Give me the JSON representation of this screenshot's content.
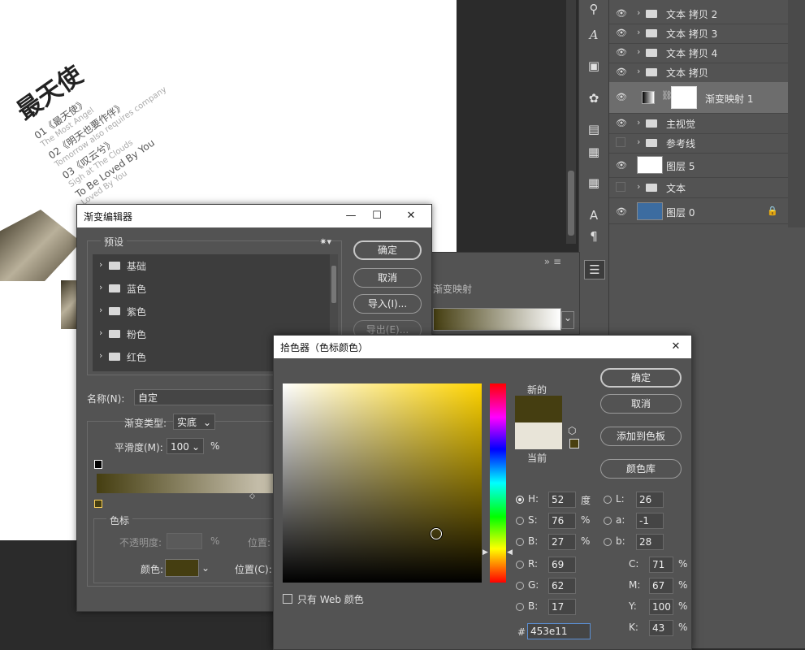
{
  "poster": {
    "title": "最天使",
    "items": [
      {
        "t": "01《最天使》",
        "s": "The Most Angel"
      },
      {
        "t": "02《明天也要作伴》",
        "s": "Tomorrow also requires company"
      },
      {
        "t": "03《叹云兮》",
        "s": "Sigh at The Clouds"
      },
      {
        "t": "To Be Loved By You",
        "s": "Loved By You"
      }
    ]
  },
  "layers": [
    {
      "name": "文本 拷贝 2",
      "type": "folder",
      "visible": true
    },
    {
      "name": "文本 拷贝 3",
      "type": "folder",
      "visible": true
    },
    {
      "name": "文本 拷贝 4",
      "type": "folder",
      "visible": true
    },
    {
      "name": "文本 拷贝",
      "type": "folder",
      "visible": true
    },
    {
      "name": "渐变映射 1",
      "type": "adjustment",
      "visible": true,
      "selected": true
    },
    {
      "name": "主视觉",
      "type": "folder",
      "visible": true
    },
    {
      "name": "参考线",
      "type": "folder",
      "visible": false
    },
    {
      "name": "图层 5",
      "type": "white",
      "visible": true
    },
    {
      "name": "文本",
      "type": "folder",
      "visible": false
    },
    {
      "name": "图层 0",
      "type": "blue",
      "visible": true,
      "locked": true
    }
  ],
  "adjpanel": {
    "title": "渐变映射"
  },
  "gradient_editor": {
    "title": "渐变编辑器",
    "presets_label": "预设",
    "presets": [
      "基础",
      "蓝色",
      "紫色",
      "粉色",
      "红色"
    ],
    "ok": "确定",
    "cancel": "取消",
    "import": "导入(I)...",
    "export": "导出(E)...",
    "name_label": "名称(N):",
    "name_value": "自定",
    "type_label": "渐变类型:",
    "type_value": "实底",
    "smooth_label": "平滑度(M):",
    "smooth_value": "100",
    "smooth_unit": "%",
    "stops_label": "色标",
    "opacity_label": "不透明度:",
    "opacity_unit": "%",
    "location_label": "位置:",
    "color_label": "颜色:",
    "location_c_label": "位置(C):",
    "stop_color": "#453e11"
  },
  "color_picker": {
    "title": "拾色器（色标颜色）",
    "ok": "确定",
    "cancel": "取消",
    "add_swatch": "添加到色板",
    "libraries": "颜色库",
    "new_label": "新的",
    "current_label": "当前",
    "new_color": "#453e11",
    "current_color": "#e8e4d8",
    "web_only": "只有 Web 颜色",
    "hsb": [
      {
        "k": "H:",
        "v": "52",
        "u": "度",
        "on": true
      },
      {
        "k": "S:",
        "v": "76",
        "u": "%"
      },
      {
        "k": "B:",
        "v": "27",
        "u": "%"
      }
    ],
    "rgb": [
      {
        "k": "R:",
        "v": "69"
      },
      {
        "k": "G:",
        "v": "62"
      },
      {
        "k": "B:",
        "v": "17"
      }
    ],
    "lab": [
      {
        "k": "L:",
        "v": "26"
      },
      {
        "k": "a:",
        "v": "-1"
      },
      {
        "k": "b:",
        "v": "28"
      }
    ],
    "cmyk": [
      {
        "k": "C:",
        "v": "71",
        "u": "%"
      },
      {
        "k": "M:",
        "v": "67",
        "u": "%"
      },
      {
        "k": "Y:",
        "v": "100",
        "u": "%"
      },
      {
        "k": "K:",
        "v": "43",
        "u": "%"
      }
    ],
    "hex_label": "#",
    "hex": "453e11"
  }
}
